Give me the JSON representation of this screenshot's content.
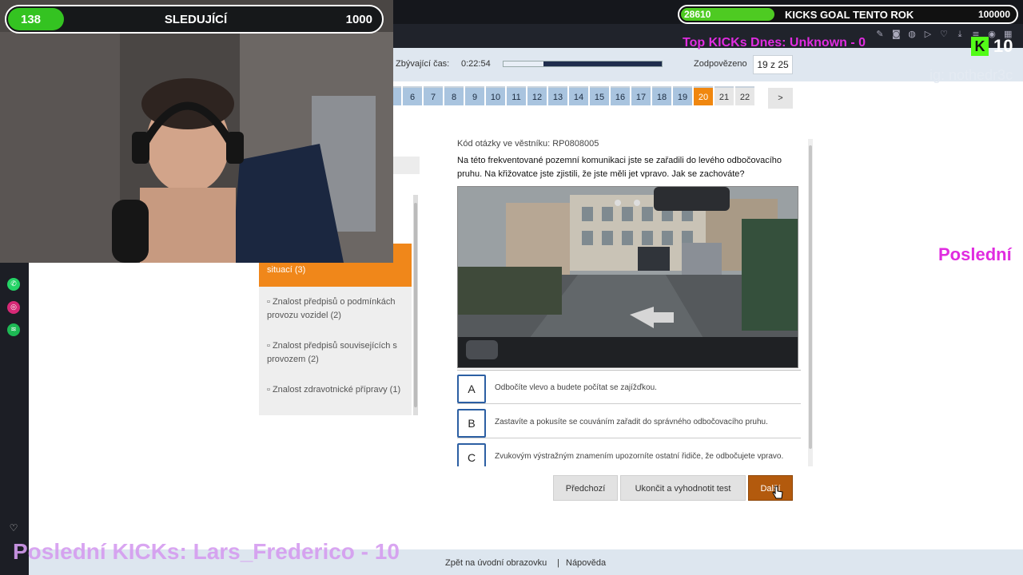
{
  "timer": {
    "label": "Zbývající čas:",
    "value": "0:22:54",
    "progress_fraction": 0.25
  },
  "answered": {
    "label": "Zodpovězeno",
    "value": "19 z 25"
  },
  "question_nav": {
    "numbers": [
      "6",
      "7",
      "8",
      "9",
      "10",
      "11",
      "12",
      "13",
      "14",
      "15",
      "16",
      "17",
      "18",
      "19",
      "20",
      "21",
      "22"
    ],
    "active": "20",
    "unanswered": [
      "21",
      "22"
    ],
    "next_label": ">"
  },
  "sidebar": {
    "active_item": "situací (3)",
    "items": [
      "▫ Znalost předpisů o podmínkách provozu vozidel (2)",
      "▫ Znalost předpisů souvisejících s provozem (2)",
      "▫ Znalost zdravotnické přípravy (1)"
    ]
  },
  "question": {
    "code_line": "Kód otázky ve věstníku: RP0808005",
    "text": "Na této frekventované pozemní komunikaci jste se zařadili do levého odbočovacího pruhu. Na křižovatce jste zjistili, že jste měli jet vpravo. Jak se zachováte?"
  },
  "answers": [
    {
      "letter": "A",
      "text": "Odbočíte vlevo a budete počítat se zajížďkou."
    },
    {
      "letter": "B",
      "text": "Zastavíte a pokusíte se couváním zařadit do správného odbočovacího pruhu."
    },
    {
      "letter": "C",
      "text": "Zvukovým výstražným znamením upozorníte ostatní řidiče, že odbočujete vpravo."
    }
  ],
  "buttons": {
    "prev": "Předchozí",
    "finish": "Ukončit a vyhodnotit test",
    "next": "Další"
  },
  "footer": {
    "home": "Zpět na úvodní obrazovku",
    "separator": "|",
    "help": "Nápověda"
  },
  "overlay": {
    "follow_current": "138",
    "follow_title": "SLEDUJÍCÍ",
    "follow_goal": "1000",
    "follow_fraction": 0.138,
    "kicks_current": "28610",
    "kicks_title": "KICKS GOAL TENTO ROK",
    "kicks_goal": "100000",
    "top_kicks": "Top KICKs Dnes: Unknown - 0",
    "k_count": "10",
    "ig": "ig: nothedr3c",
    "posledni_right": "Poslední",
    "last_kicks": "Poslední KICKs: Lars_Frederico - 10"
  },
  "icons": {
    "rail": [
      "whatsapp-icon",
      "instagram-icon",
      "spotify-icon",
      "heart-icon"
    ],
    "brand_colors": {
      "accent": "#f0870f",
      "nav": "#a9c4df",
      "kick_green": "#53fc18",
      "overlay_pink": "#e02ce0"
    }
  }
}
